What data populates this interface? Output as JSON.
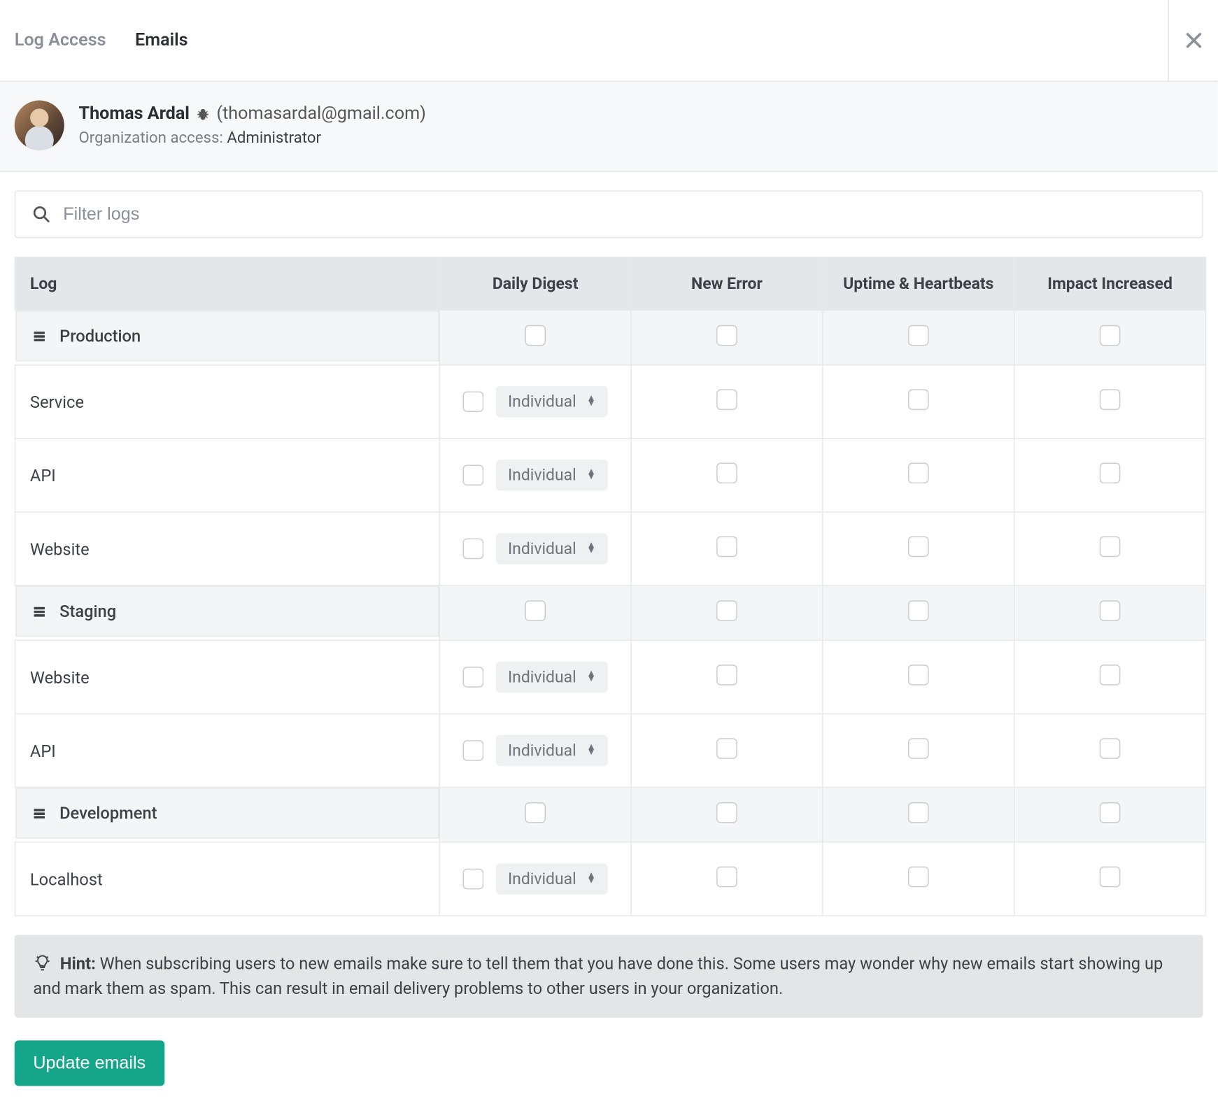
{
  "tabs": {
    "log_access": "Log Access",
    "emails": "Emails"
  },
  "user": {
    "name": "Thomas Ardal",
    "email_paren": "(thomasardal@gmail.com)",
    "org_label": "Organization access:",
    "org_role": "Administrator"
  },
  "filter": {
    "placeholder": "Filter logs"
  },
  "columns": {
    "log": "Log",
    "daily_digest": "Daily Digest",
    "new_error": "New Error",
    "uptime": "Uptime & Heartbeats",
    "impact": "Impact Increased"
  },
  "dropdown_label": "Individual",
  "groups": [
    {
      "name": "Production",
      "rows": [
        {
          "name": "Service"
        },
        {
          "name": "API"
        },
        {
          "name": "Website"
        }
      ]
    },
    {
      "name": "Staging",
      "rows": [
        {
          "name": "Website"
        },
        {
          "name": "API"
        }
      ]
    },
    {
      "name": "Development",
      "rows": [
        {
          "name": "Localhost"
        }
      ]
    }
  ],
  "hint": {
    "label": "Hint:",
    "text": "When subscribing users to new emails make sure to tell them that you have done this. Some users may wonder why new emails start showing up and mark them as spam. This can result in email delivery problems to other users in your organization."
  },
  "update_button": "Update emails"
}
